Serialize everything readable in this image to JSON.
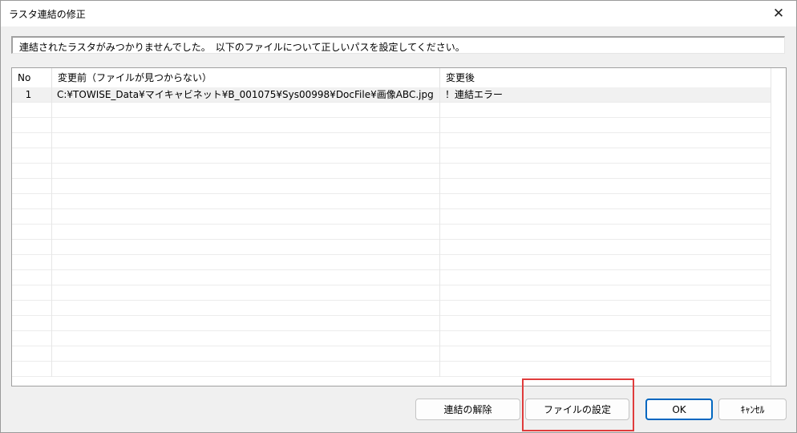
{
  "window": {
    "title": "ラスタ連結の修正",
    "close_glyph": "✕"
  },
  "message": "連結されたラスタがみつかりませんでした。　以下のファイルについて正しいパスを設定してください。",
  "table": {
    "columns": [
      "No",
      "変更前（ファイルが見つからない）",
      "変更後"
    ],
    "rows": [
      {
        "no": "1",
        "before": "C:¥TOWISE_Data¥マイキャビネット¥B_001075¥Sys00998¥DocFile¥画像ABC.jpg",
        "after": "！連結エラー"
      }
    ]
  },
  "buttons": {
    "unlink": "連結の解除",
    "set_file": "ファイルの設定",
    "ok": "OK",
    "cancel": "ｷｬﾝｾﾙ"
  },
  "colors": {
    "highlight": "#e03c3c",
    "primary_border": "#0067c0"
  }
}
